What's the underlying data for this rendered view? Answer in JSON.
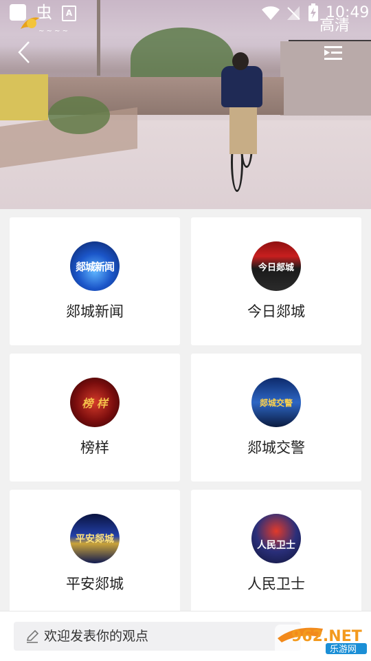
{
  "status_bar": {
    "glyph": "虫",
    "a_label": "A",
    "time": "10:49"
  },
  "player": {
    "quality_label": "高清"
  },
  "channels": [
    {
      "name": "郯城新闻",
      "thumb_text": "郯城新闻"
    },
    {
      "name": "今日郯城",
      "thumb_text": "今日郯城"
    },
    {
      "name": "榜样",
      "thumb_text": "榜 样"
    },
    {
      "name": "郯城交警",
      "thumb_text": "郯城交警"
    },
    {
      "name": "平安郯城",
      "thumb_text": "平安郯城"
    },
    {
      "name": "人民卫士",
      "thumb_text": "人民卫士"
    }
  ],
  "comment_bar": {
    "placeholder": "欢迎发表你的观点"
  },
  "watermark": {
    "line1": "962.NET",
    "line2": "乐游网"
  },
  "colors": {
    "background": "#f1f1f1",
    "card": "#ffffff",
    "text": "#222222"
  }
}
